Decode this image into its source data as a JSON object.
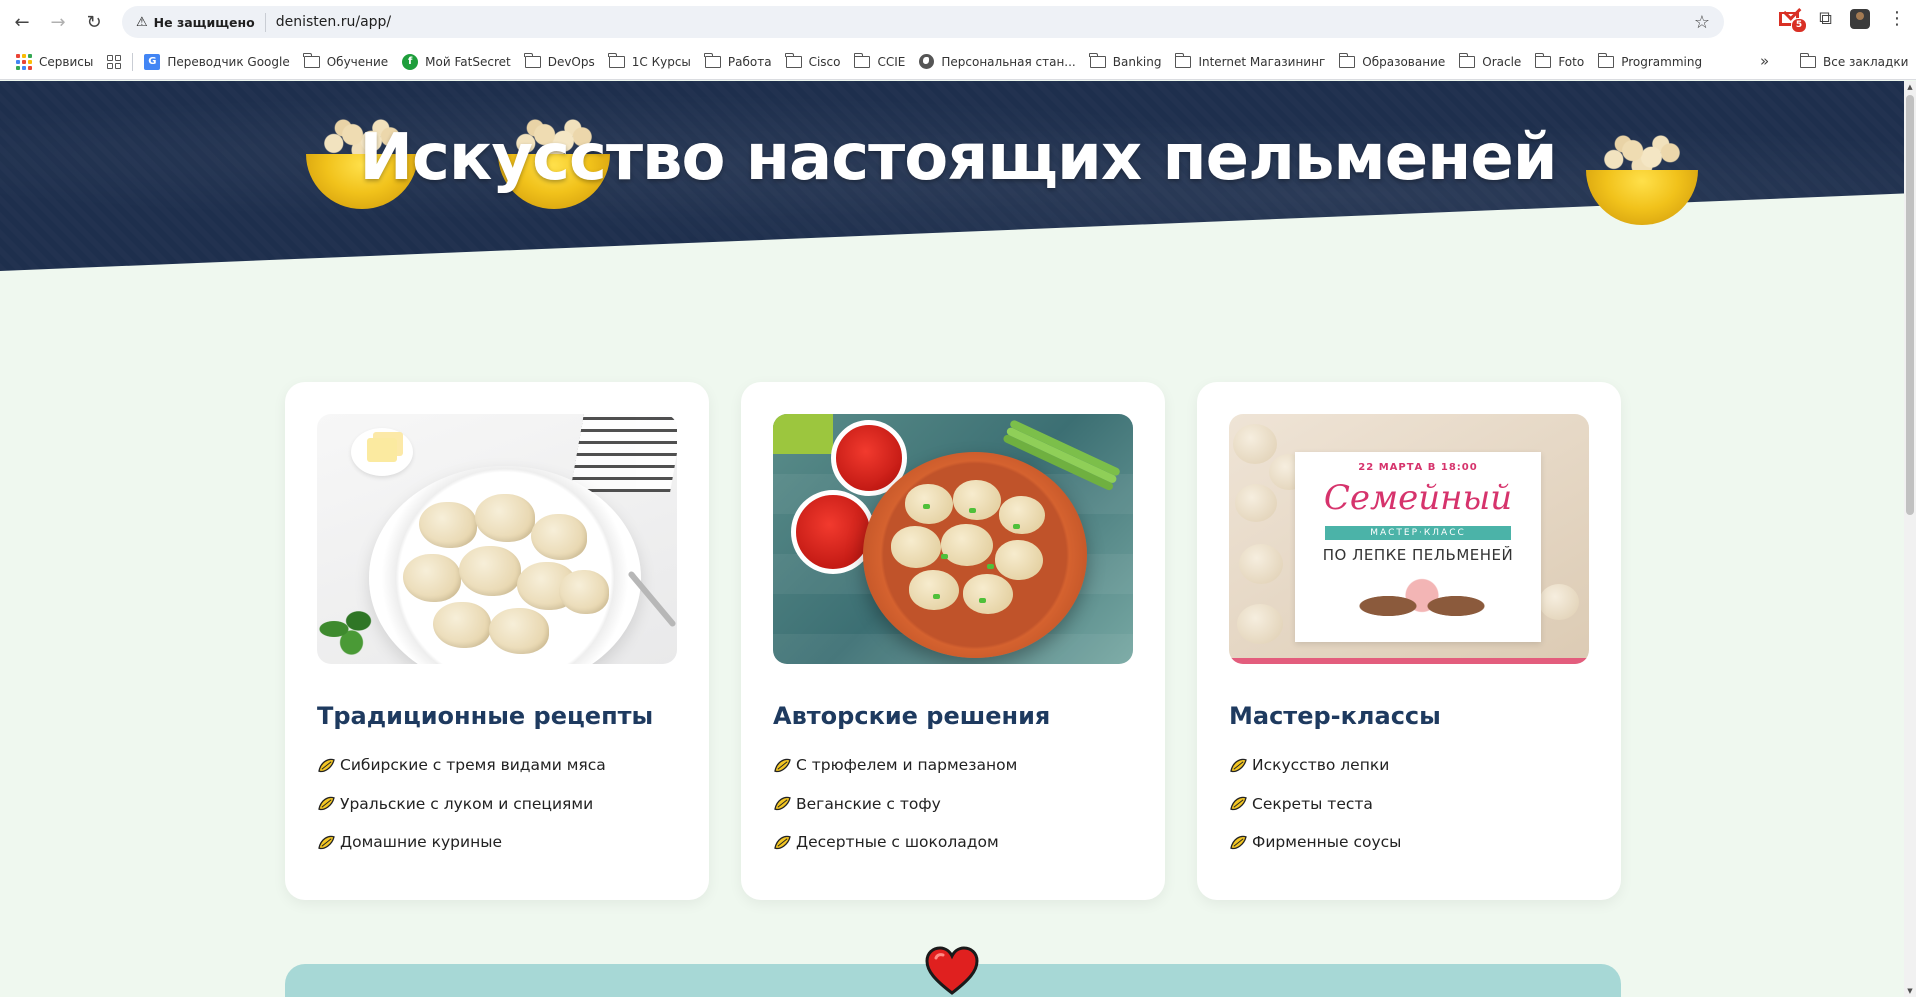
{
  "browser": {
    "security_label": "Не защищено",
    "url": "denisten.ru/app/",
    "notification_count": "5",
    "bookmarks": [
      {
        "label": "Сервисы",
        "icon": "apps-icon"
      },
      {
        "label": "",
        "icon": "grid-icon"
      },
      {
        "label": "Переводчик Google",
        "icon": "translate-icon"
      },
      {
        "label": "Обучение",
        "icon": "folder-icon"
      },
      {
        "label": "Мой FatSecret",
        "icon": "fatsecret-icon"
      },
      {
        "label": "DevOps",
        "icon": "folder-icon"
      },
      {
        "label": "1С Курсы",
        "icon": "folder-icon"
      },
      {
        "label": "Работа",
        "icon": "folder-icon"
      },
      {
        "label": "Cisco",
        "icon": "folder-icon"
      },
      {
        "label": "CCIE",
        "icon": "folder-icon"
      },
      {
        "label": "Персональная стан...",
        "icon": "globe-icon"
      },
      {
        "label": "Banking",
        "icon": "folder-icon"
      },
      {
        "label": "Internet Магазининг",
        "icon": "folder-icon"
      },
      {
        "label": "Образование",
        "icon": "folder-icon"
      },
      {
        "label": "Oracle",
        "icon": "folder-icon"
      },
      {
        "label": "Foto",
        "icon": "folder-icon"
      },
      {
        "label": "Programming",
        "icon": "folder-icon"
      }
    ],
    "more_label": "»",
    "all_bookmarks_label": "Все закладки"
  },
  "hero": {
    "title": "Искусство настоящих пельменей"
  },
  "cards": [
    {
      "title": "Традиционные рецепты",
      "items": [
        "Сибирские с тремя видами мяса",
        "Уральские с луком и специями",
        "Домашние куриные"
      ]
    },
    {
      "title": "Авторские решения",
      "items": [
        "С трюфелем и пармезаном",
        "Веганские с тофу",
        "Десертные с шоколадом"
      ]
    },
    {
      "title": "Мастер-классы",
      "items": [
        "Искусство лепки",
        "Секреты теста",
        "Фирменные соусы"
      ]
    }
  ],
  "poster": {
    "date": "22 МАРТА В 18:00",
    "title": "Семейный",
    "ribbon": "МАСТЕР·КЛАСС",
    "subtitle": "ПО ЛЕПКЕ ПЕЛЬМЕНЕЙ"
  },
  "colors": {
    "hero_bg": "#1e2f4d",
    "page_bg": "#eff8ef",
    "card_title": "#1e3a5f",
    "love_banner": "#a7d8d6",
    "heart": "#e0201f"
  }
}
